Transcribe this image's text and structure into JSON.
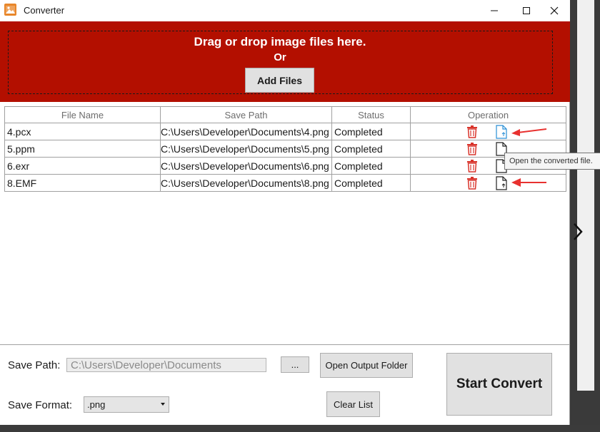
{
  "window": {
    "title": "Converter",
    "icon": "picture-app-icon"
  },
  "dropzone": {
    "headline": "Drag or drop image files here.",
    "or_text": "Or",
    "add_files_label": "Add Files",
    "color": "#b30f00"
  },
  "table": {
    "columns": [
      "File Name",
      "Save Path",
      "Status",
      "Operation"
    ],
    "rows": [
      {
        "file_name": "4.pcx",
        "save_path": "C:\\Users\\Developer\\Documents\\4.png",
        "status": "Completed",
        "highlighted": true
      },
      {
        "file_name": "5.ppm",
        "save_path": "C:\\Users\\Developer\\Documents\\5.png",
        "status": "Completed",
        "highlighted": false
      },
      {
        "file_name": "6.exr",
        "save_path": "C:\\Users\\Developer\\Documents\\6.png",
        "status": "Completed",
        "highlighted": false
      },
      {
        "file_name": "8.EMF",
        "save_path": "C:\\Users\\Developer\\Documents\\8.png",
        "status": "Completed",
        "highlighted": true
      }
    ],
    "operation_icons": [
      "trash-icon",
      "open-file-icon"
    ]
  },
  "tooltip": {
    "text": "Open the converted file."
  },
  "footer": {
    "save_path_label": "Save Path:",
    "save_path_value": "C:\\Users\\Developer\\Documents",
    "browse_label": "...",
    "open_output_label": "Open Output Folder",
    "save_format_label": "Save Format:",
    "save_format_value": ".png",
    "clear_list_label": "Clear List",
    "start_convert_label": "Start Convert"
  },
  "colors": {
    "accent_red": "#b30f00",
    "annotation_arrow": "#e8312f",
    "trash_red": "#d9342b"
  }
}
